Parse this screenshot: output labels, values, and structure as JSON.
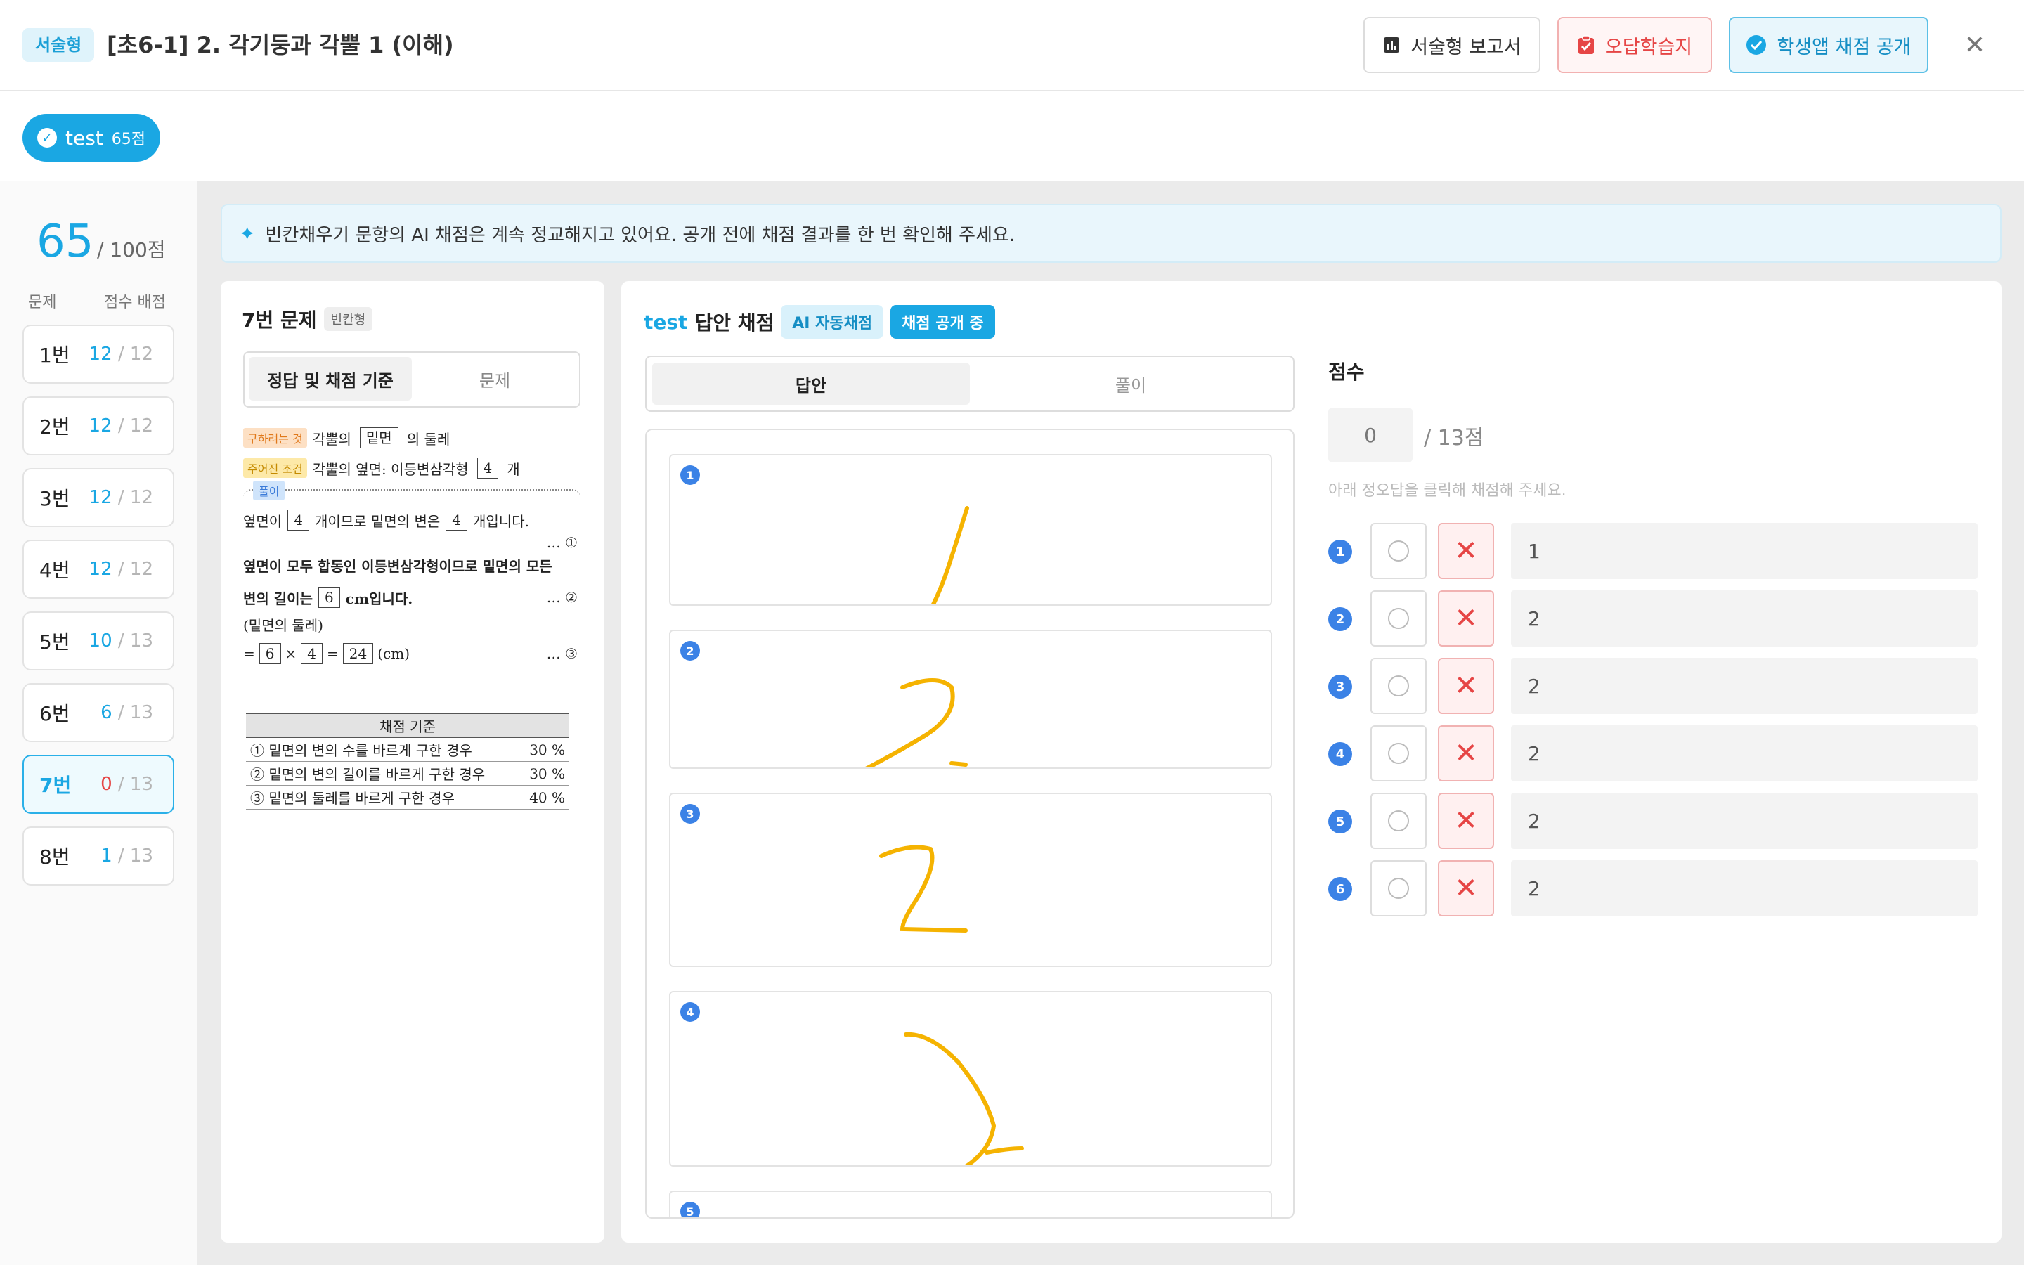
{
  "header": {
    "type_badge": "서술형",
    "title": "[초6-1] 2. 각기둥과 각뿔 1 (이해)",
    "report_label": "서술형 보고서",
    "wrong_note_label": "오답학습지",
    "publish_label": "학생앱 채점 공개",
    "close_icon": "close-icon"
  },
  "student": {
    "name": "test",
    "score_label": "65점"
  },
  "summary": {
    "score": "65",
    "total": "/ 100점",
    "col_question": "문제",
    "col_score": "점수 배점"
  },
  "questions": [
    {
      "label": "1번",
      "got": "12",
      "of": "/ 12"
    },
    {
      "label": "2번",
      "got": "12",
      "of": "/ 12"
    },
    {
      "label": "3번",
      "got": "12",
      "of": "/ 12"
    },
    {
      "label": "4번",
      "got": "12",
      "of": "/ 12"
    },
    {
      "label": "5번",
      "got": "10",
      "of": "/ 13"
    },
    {
      "label": "6번",
      "got": "6",
      "of": "/ 13"
    },
    {
      "label": "7번",
      "got": "0",
      "of": "/ 13"
    },
    {
      "label": "8번",
      "got": "1",
      "of": "/ 13"
    }
  ],
  "notice": "빈칸채우기 문항의 AI 채점은 계속 정교해지고 있어요. 공개 전에 채점 결과를 한 번 확인해 주세요.",
  "question_panel": {
    "title": "7번 문제",
    "type": "빈칸형",
    "tab_active": "정답 및 채점 기준",
    "tab_other": "문제",
    "doc": {
      "tag_find": "구하려는 것",
      "find_a": "각뿔의",
      "find_box": "밑면",
      "find_b": "의 둘레",
      "tag_given": "주어진 조건",
      "given_a": "각뿔의 옆면: 이등변삼각형",
      "given_box": "4",
      "given_b": "개",
      "sol_tag": "풀이",
      "l1_a": "옆면이",
      "l1_box1": "4",
      "l1_b": "개이므로 밑면의 변은",
      "l1_box2": "4",
      "l1_c": "개입니다.",
      "m1": "… ①",
      "l2": "옆면이 모두 합동인 이등변삼각형이므로 밑면의 모든",
      "l3_a": "변의 길이는",
      "l3_box": "6",
      "l3_b": "cm입니다.",
      "m2": "… ②",
      "l4": "(밑면의 둘레)",
      "l5_eq": "=",
      "l5_box1": "6",
      "l5_x": "×",
      "l5_box2": "4",
      "l5_eq2": "=",
      "l5_box3": "24",
      "l5_unit": "(cm)",
      "m3": "… ③"
    },
    "criteria_header": "채점 기준",
    "criteria": [
      {
        "text": "① 밑면의 변의 수를 바르게 구한 경우",
        "pct": "30 %"
      },
      {
        "text": "② 밑면의 변의 길이를 바르게 구한 경우",
        "pct": "30 %"
      },
      {
        "text": "③ 밑면의 둘레를 바르게 구한 경우",
        "pct": "40 %"
      }
    ]
  },
  "grading": {
    "student": "test",
    "title_suffix": "답안 채점",
    "chip_ai": "AI 자동채점",
    "chip_pub": "채점 공개 중",
    "tab_answer": "답안",
    "tab_solution": "풀이",
    "answer_numbers": [
      "1",
      "2",
      "3",
      "4",
      "5"
    ],
    "score_label": "점수",
    "score_value": "0",
    "score_max": "/ 13점",
    "hint": "아래 정오답을 클릭해 채점해 주세요.",
    "rows": [
      {
        "num": "1",
        "answer": "1"
      },
      {
        "num": "2",
        "answer": "2"
      },
      {
        "num": "3",
        "answer": "2"
      },
      {
        "num": "4",
        "answer": "2"
      },
      {
        "num": "5",
        "answer": "2"
      },
      {
        "num": "6",
        "answer": "2"
      }
    ],
    "colors": {
      "accent": "#1aa7e3",
      "wrong": "#e64545",
      "ink": "#f5b301"
    }
  }
}
